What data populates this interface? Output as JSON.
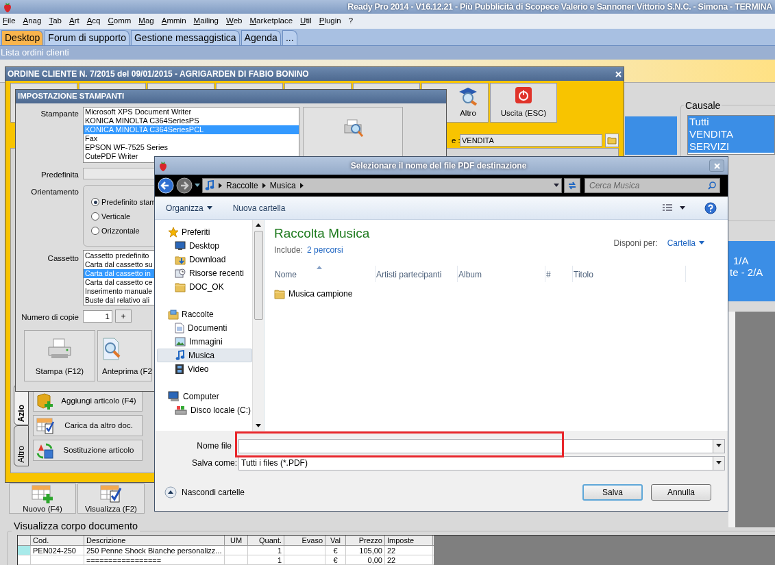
{
  "title_bar": {
    "title": "Ready Pro 2014 - V16.12.21 - Più Pubblicità di Scopece Valerio e Sannoner Vittorio S.N.C. - Simona - TERMINA"
  },
  "menu": [
    "File",
    "Anag",
    "Tab",
    "Art",
    "Acq",
    "Comm",
    "Mag",
    "Ammin",
    "Mailing",
    "Web",
    "Marketplace",
    "Util",
    "Plugin",
    "?"
  ],
  "tabs": [
    {
      "label": "Desktop",
      "selected": true
    },
    {
      "label": "Forum di supporto",
      "selected": false
    },
    {
      "label": "Gestione messaggistica",
      "selected": false
    },
    {
      "label": "Agenda",
      "selected": false
    },
    {
      "label": "...",
      "selected": false
    }
  ],
  "section_title": "Lista ordini clienti",
  "orders_view": {
    "causale": {
      "label": "Causale",
      "items": [
        {
          "label": "Tutti",
          "selected": true
        },
        {
          "label": "VENDITA",
          "selected": true
        },
        {
          "label": "SERVIZI",
          "selected": true
        }
      ]
    },
    "series": [
      "1/A",
      "te - 2/A"
    ],
    "buttons": [
      {
        "label": "Nuovo (F4)",
        "kind": "new"
      },
      {
        "label": "Visualizza (F2)",
        "kind": "view"
      }
    ],
    "body": {
      "title": "Visualizza corpo documento",
      "columns": [
        "Cod.",
        "Descrizione",
        "UM",
        "Quant.",
        "Evaso",
        "Val",
        "Prezzo",
        "Imposte"
      ],
      "rows": [
        {
          "selected": true,
          "cells": [
            "PEN024-250",
            "250 Penne Shock Bianche personalizz...",
            null,
            "1",
            null,
            "€",
            "105,00",
            "22"
          ]
        },
        {
          "selected": false,
          "cells": [
            null,
            "=================",
            null,
            "1",
            null,
            "€",
            "0,00",
            "22"
          ]
        }
      ]
    }
  },
  "order_window": {
    "title": "ORDINE CLIENTE N. 7/2015 del 09/01/2015 - AGRIGARDEN DI FABIO BONINO",
    "toolbar": [
      {
        "label": "Altro",
        "kind": "other"
      },
      {
        "label": "Uscita (ESC)",
        "kind": "exit"
      }
    ],
    "causale_field": {
      "label": "e :",
      "value": "VENDITA"
    },
    "side_tabs": [
      {
        "label": "Azio",
        "selected": true
      },
      {
        "label": "Altro",
        "selected": false
      }
    ],
    "actions": [
      {
        "label": "Aggiungi articolo (F4)",
        "kind": "add"
      },
      {
        "label": "Carica da altro doc.",
        "kind": "load"
      },
      {
        "label": "Sostituzione articolo",
        "kind": "replace"
      }
    ]
  },
  "printer_dialog": {
    "title": "IMPOSTAZIONE STAMPANTI",
    "printer_label": "Stampante",
    "printers": [
      {
        "label": "Microsoft XPS Document Writer",
        "selected": false
      },
      {
        "label": "KONICA MINOLTA C364SeriesPS",
        "selected": false
      },
      {
        "label": "KONICA MINOLTA C364SeriesPCL",
        "selected": true
      },
      {
        "label": "Fax",
        "selected": false
      },
      {
        "label": "EPSON WF-7525 Series",
        "selected": false
      },
      {
        "label": "CutePDF Writer",
        "selected": false
      }
    ],
    "default_label": "Predefinita",
    "orientation_label": "Orientamento",
    "orientations": [
      {
        "label": "Predefinito stam",
        "selected": true
      },
      {
        "label": "Verticale",
        "selected": false
      },
      {
        "label": "Orizzontale",
        "selected": false
      }
    ],
    "tray_label": "Cassetto",
    "trays": [
      {
        "label": "Cassetto predefinito",
        "selected": false
      },
      {
        "label": "Carta dal cassetto su",
        "selected": false
      },
      {
        "label": "Carta dal cassetto in",
        "selected": true
      },
      {
        "label": "Carta dal cassetto ce",
        "selected": false
      },
      {
        "label": "Inserimento manuale",
        "selected": false
      },
      {
        "label": "Buste dal relativo ali",
        "selected": false
      }
    ],
    "copies_label": "Numero di copie",
    "copies": "1",
    "increment": "+",
    "buttons": [
      {
        "label": "Stampa (F12)",
        "kind": "print"
      },
      {
        "label": "Anteprima (F2",
        "kind": "preview"
      }
    ]
  },
  "file_dialog": {
    "title": "Selezionare il nome del file PDF destinazione",
    "path": [
      "Raccolte",
      "Musica"
    ],
    "search_placeholder": "Cerca Musica",
    "toolbar": [
      {
        "label": "Organizza",
        "kind": "menu"
      },
      {
        "label": "Nuova cartella",
        "kind": "button"
      }
    ],
    "nav": [
      {
        "label": "Preferiti",
        "kind": "star",
        "selected": false,
        "children": [
          {
            "label": "Desktop",
            "kind": "desktop",
            "selected": false
          },
          {
            "label": "Download",
            "kind": "download",
            "selected": false
          },
          {
            "label": "Risorse recenti",
            "kind": "recent",
            "selected": false
          },
          {
            "label": "DOC_OK",
            "kind": "folder",
            "selected": false
          }
        ]
      },
      {
        "label": "Raccolte",
        "kind": "library",
        "selected": false,
        "children": [
          {
            "label": "Documenti",
            "kind": "document",
            "selected": false
          },
          {
            "label": "Immagini",
            "kind": "picture",
            "selected": false
          },
          {
            "label": "Musica",
            "kind": "music",
            "selected": true
          },
          {
            "label": "Video",
            "kind": "video",
            "selected": false
          }
        ]
      },
      {
        "label": "Computer",
        "kind": "computer",
        "selected": false,
        "children": [
          {
            "label": "Disco locale (C:)",
            "kind": "drive",
            "selected": false
          }
        ]
      }
    ],
    "library_title": "Raccolta Musica",
    "include_label": "Include:",
    "include_link": "2 percorsi",
    "arrange_label": "Disponi per:",
    "arrange_value": "Cartella",
    "columns": [
      "Nome",
      "Artisti partecipanti",
      "Album",
      "#",
      "Titolo"
    ],
    "items": [
      {
        "label": "Musica campione",
        "kind": "folder"
      }
    ],
    "filename_label": "Nome file",
    "type_label": "Salva come:",
    "type_value": "Tutti i files (*.PDF)",
    "hide_folders": "Nascondi cartelle",
    "buttons": [
      {
        "label": "Salva",
        "kind": "primary"
      },
      {
        "label": "Annulla",
        "kind": "secondary"
      }
    ]
  }
}
